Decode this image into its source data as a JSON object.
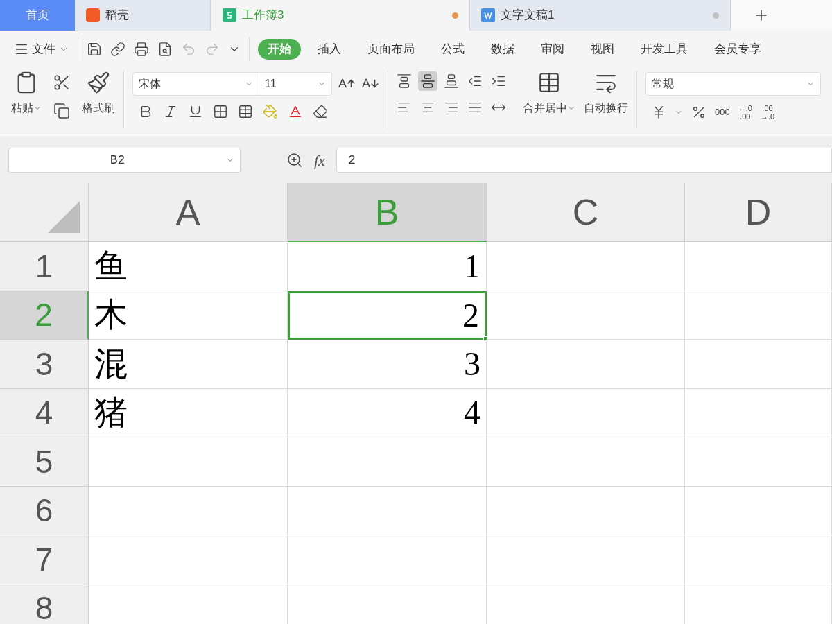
{
  "tabs": [
    {
      "label": "首页",
      "kind": "home",
      "selected": false
    },
    {
      "label": "稻壳",
      "kind": "docer",
      "selected": false
    },
    {
      "label": "工作簿3",
      "kind": "sheet",
      "selected": true,
      "unsaved": true
    },
    {
      "label": "文字文稿1",
      "kind": "writer",
      "selected": false,
      "unsaved": false
    }
  ],
  "menu": {
    "file": "文件",
    "items": [
      {
        "label": "开始",
        "selected": true
      },
      {
        "label": "插入",
        "selected": false
      },
      {
        "label": "页面布局",
        "selected": false
      },
      {
        "label": "公式",
        "selected": false
      },
      {
        "label": "数据",
        "selected": false
      },
      {
        "label": "审阅",
        "selected": false
      },
      {
        "label": "视图",
        "selected": false
      },
      {
        "label": "开发工具",
        "selected": false
      },
      {
        "label": "会员专享",
        "selected": false
      }
    ]
  },
  "ribbon": {
    "paste": "粘贴",
    "format_painter": "格式刷",
    "font": "宋体",
    "size": "11",
    "merge": "合并居中",
    "wrap": "自动换行",
    "number_format": "常规",
    "thousands": "000",
    "decimal_add": {
      "top": "←.0",
      "bottom": ".00"
    },
    "decimal_remove": {
      "top": ".00",
      "bottom": "→.0"
    }
  },
  "formula_bar": {
    "cell": "B2",
    "fx": "fx",
    "value": "2"
  },
  "sheet": {
    "columns": [
      {
        "label": "A",
        "selected": false
      },
      {
        "label": "B",
        "selected": true
      },
      {
        "label": "C",
        "selected": false
      },
      {
        "label": "D",
        "selected": false
      }
    ],
    "rows": [
      {
        "label": "1",
        "selected": false,
        "cells": [
          {
            "text": "鱼",
            "selected": false
          },
          {
            "text": "1",
            "selected": false
          }
        ]
      },
      {
        "label": "2",
        "selected": true,
        "cells": [
          {
            "text": "木",
            "selected": false
          },
          {
            "text": "2",
            "selected": true
          }
        ]
      },
      {
        "label": "3",
        "selected": false,
        "cells": [
          {
            "text": "混",
            "selected": false
          },
          {
            "text": "3",
            "selected": false
          }
        ]
      },
      {
        "label": "4",
        "selected": false,
        "cells": [
          {
            "text": "猪",
            "selected": false
          },
          {
            "text": "4",
            "selected": false
          }
        ]
      },
      {
        "label": "5",
        "selected": false
      },
      {
        "label": "6",
        "selected": false
      },
      {
        "label": "7",
        "selected": false
      },
      {
        "label": "8",
        "selected": false
      }
    ]
  }
}
